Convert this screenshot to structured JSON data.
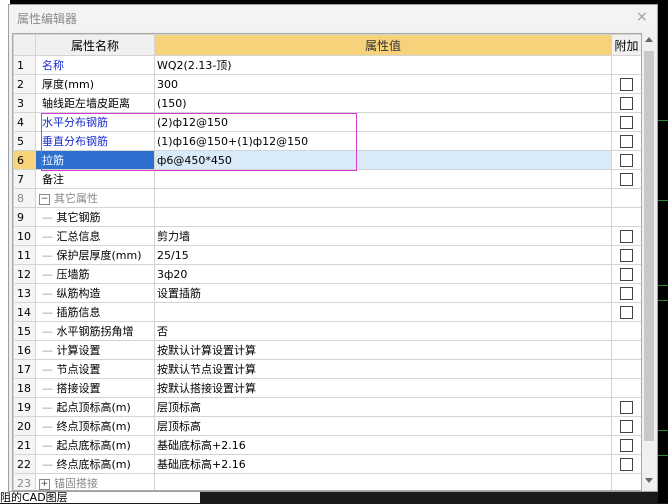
{
  "dialog": {
    "title": "属性编辑器",
    "close": "×"
  },
  "columns": {
    "num": "",
    "name": "属性名称",
    "value": "属性值",
    "extra": "附加"
  },
  "rows": [
    {
      "num": "1",
      "name": "名称",
      "value": "WQ2(2.13-顶)",
      "blue": true,
      "check": false
    },
    {
      "num": "2",
      "name": "厚度(mm)",
      "value": "300",
      "check": true
    },
    {
      "num": "3",
      "name": "轴线距左墙皮距离",
      "value": "(150)",
      "check": true
    },
    {
      "num": "4",
      "name": "水平分布钢筋",
      "value": "(2)ф12@150",
      "blue": true,
      "check": true
    },
    {
      "num": "5",
      "name": "垂直分布钢筋",
      "value": "(1)ф16@150+(1)ф12@150",
      "blue": true,
      "check": true
    },
    {
      "num": "6",
      "name": "拉筋",
      "value": "ф6@450*450",
      "selected": true,
      "check": true
    },
    {
      "num": "7",
      "name": "备注",
      "value": "",
      "check": true
    },
    {
      "num": "8",
      "name": "其它属性",
      "value": "",
      "group": true,
      "expander": "−",
      "check": false
    },
    {
      "num": "9",
      "name": "其它钢筋",
      "value": "",
      "child": true,
      "check": false
    },
    {
      "num": "10",
      "name": "汇总信息",
      "value": "剪力墙",
      "child": true,
      "check": true
    },
    {
      "num": "11",
      "name": "保护层厚度(mm)",
      "value": "25/15",
      "child": true,
      "check": true
    },
    {
      "num": "12",
      "name": "压墙筋",
      "value": "3ф20",
      "child": true,
      "check": true
    },
    {
      "num": "13",
      "name": "纵筋构造",
      "value": "设置插筋",
      "child": true,
      "check": true
    },
    {
      "num": "14",
      "name": "插筋信息",
      "value": "",
      "child": true,
      "check": true
    },
    {
      "num": "15",
      "name": "水平钢筋拐角增",
      "value": "否",
      "child": true,
      "check": false
    },
    {
      "num": "16",
      "name": "计算设置",
      "value": "按默认计算设置计算",
      "child": true,
      "check": false
    },
    {
      "num": "17",
      "name": "节点设置",
      "value": "按默认节点设置计算",
      "child": true,
      "check": false
    },
    {
      "num": "18",
      "name": "搭接设置",
      "value": "按默认搭接设置计算",
      "child": true,
      "check": false
    },
    {
      "num": "19",
      "name": "起点顶标高(m)",
      "value": "层顶标高",
      "child": true,
      "check": true
    },
    {
      "num": "20",
      "name": "终点顶标高(m)",
      "value": "层顶标高",
      "child": true,
      "check": true
    },
    {
      "num": "21",
      "name": "起点底标高(m)",
      "value": "基础底标高+2.16",
      "child": true,
      "check": true
    },
    {
      "num": "22",
      "name": "终点底标高(m)",
      "value": "基础底标高+2.16",
      "child": true,
      "check": true
    },
    {
      "num": "23",
      "name": "锚固搭接",
      "value": "",
      "group": true,
      "expander": "+",
      "check": false
    }
  ],
  "background": {
    "bottom_text": "阻的CAD图层"
  }
}
